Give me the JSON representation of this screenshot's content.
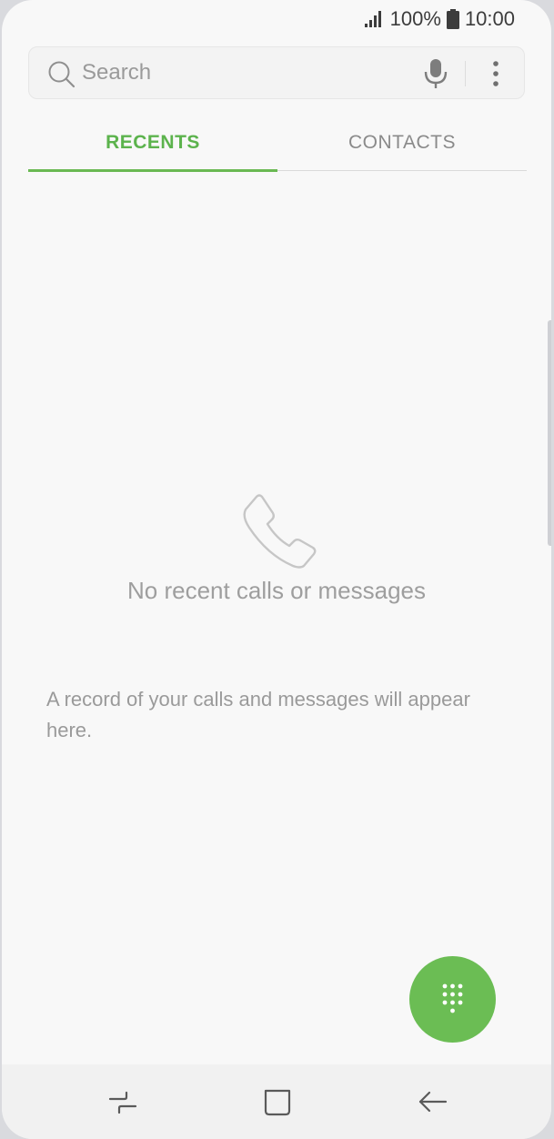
{
  "status_bar": {
    "battery": "100%",
    "time": "10:00",
    "icons": [
      "signal-icon",
      "battery-icon"
    ]
  },
  "search": {
    "placeholder": "Search",
    "icons": [
      "search-icon",
      "microphone-icon",
      "more-options-icon"
    ]
  },
  "tabs": [
    {
      "label": "RECENTS",
      "selected": true
    },
    {
      "label": "CONTACTS",
      "selected": false
    }
  ],
  "empty_state": {
    "icon": "phone-icon",
    "title": "No recent calls or messages",
    "description": "A record of your calls and messages will appear here."
  },
  "fab": {
    "icon": "dialpad-icon"
  },
  "nav_bar": {
    "icons": [
      "recent-apps-icon",
      "home-icon",
      "back-icon"
    ]
  },
  "colors": {
    "accent": "#5cb34d",
    "fab": "#6bbd54",
    "background": "#f8f8f8"
  }
}
